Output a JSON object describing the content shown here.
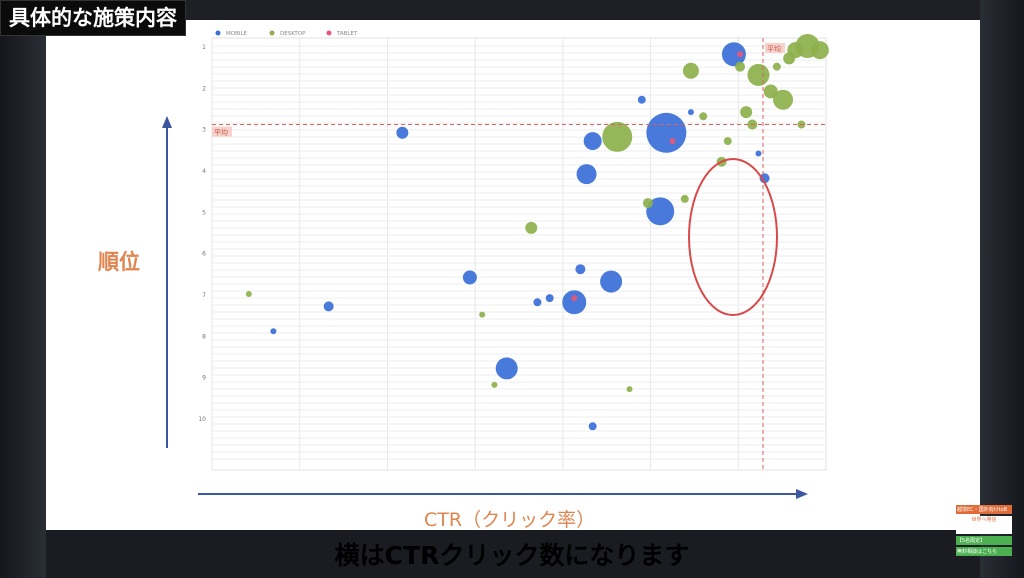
{
  "video": {
    "title_badge": "具体的な施策内容",
    "caption": "横はCTRクリック数になります"
  },
  "slide": {
    "y_axis_label": "順位",
    "x_axis_label": "CTR（クリック率）"
  },
  "ad": {
    "line1": "越境EC・国外向けtoB",
    "line2": "世界へ発信",
    "line3": "【5名限定】",
    "line4": "無料相談はこちら"
  },
  "chart_data": {
    "type": "scatter",
    "legend": [
      "MOBILE",
      "DESKTOP",
      "TABLET"
    ],
    "legend_placement": "top-left",
    "colors": {
      "MOBILE": "#3a6fd8",
      "DESKTOP": "#8db04c",
      "TABLET": "#e8567a",
      "average": "#e06060",
      "ellipse": "#d84a4a"
    },
    "y_ticks": [
      "1",
      "2",
      "3",
      "4",
      "5",
      "6",
      "7",
      "8",
      "9",
      "10"
    ],
    "average_label": "平均",
    "y_average": 2.9,
    "ylim": [
      1,
      10.9
    ],
    "xlim": [
      0,
      1
    ],
    "grid": true,
    "annotation": {
      "shape": "ellipse",
      "color": "#d84a4a"
    },
    "series": [
      {
        "name": "MOBILE",
        "points": [
          [
            0.85,
            1.2,
            12
          ],
          [
            0.74,
            3.1,
            20
          ],
          [
            0.62,
            3.3,
            9
          ],
          [
            0.31,
            3.1,
            6
          ],
          [
            0.61,
            4.1,
            10
          ],
          [
            0.73,
            5.0,
            14
          ],
          [
            0.65,
            6.7,
            11
          ],
          [
            0.59,
            7.2,
            12
          ],
          [
            0.48,
            8.8,
            11
          ],
          [
            0.6,
            6.4,
            5
          ],
          [
            0.42,
            6.6,
            7
          ],
          [
            0.19,
            7.3,
            5
          ],
          [
            0.9,
            4.2,
            5
          ],
          [
            0.62,
            10.2,
            4
          ],
          [
            0.53,
            7.2,
            4
          ],
          [
            0.55,
            7.1,
            4
          ],
          [
            0.1,
            7.9,
            3
          ],
          [
            0.7,
            2.3,
            4
          ],
          [
            0.78,
            2.6,
            3
          ],
          [
            0.89,
            3.6,
            3
          ]
        ]
      },
      {
        "name": "DESKTOP",
        "points": [
          [
            0.66,
            3.2,
            15
          ],
          [
            0.89,
            1.7,
            11
          ],
          [
            0.93,
            2.3,
            10
          ],
          [
            0.78,
            1.6,
            8
          ],
          [
            0.91,
            2.1,
            7
          ],
          [
            0.86,
            1.5,
            5
          ],
          [
            0.52,
            5.4,
            6
          ],
          [
            0.88,
            2.9,
            5
          ],
          [
            0.83,
            3.8,
            5
          ],
          [
            0.87,
            2.6,
            6
          ],
          [
            0.95,
            1.1,
            8
          ],
          [
            0.97,
            1.0,
            12
          ],
          [
            0.99,
            1.1,
            9
          ],
          [
            0.94,
            1.3,
            6
          ],
          [
            0.92,
            1.5,
            4
          ],
          [
            0.71,
            4.8,
            5
          ],
          [
            0.77,
            4.7,
            4
          ],
          [
            0.84,
            3.3,
            4
          ],
          [
            0.8,
            2.7,
            4
          ],
          [
            0.06,
            7.0,
            3
          ],
          [
            0.44,
            7.5,
            3
          ],
          [
            0.46,
            9.2,
            3
          ],
          [
            0.68,
            9.3,
            3
          ],
          [
            0.96,
            2.9,
            4
          ]
        ]
      },
      {
        "name": "TABLET",
        "points": [
          [
            0.86,
            1.2,
            3
          ],
          [
            0.75,
            3.3,
            3
          ],
          [
            0.59,
            7.1,
            3
          ]
        ]
      }
    ]
  }
}
